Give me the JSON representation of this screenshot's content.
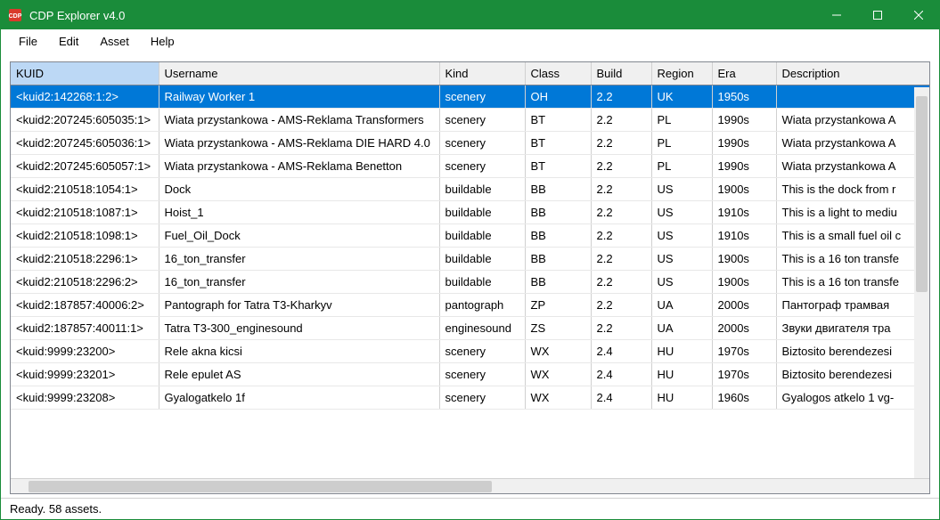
{
  "window": {
    "title": "CDP Explorer v4.0"
  },
  "menu": {
    "file": "File",
    "edit": "Edit",
    "asset": "Asset",
    "help": "Help"
  },
  "table": {
    "headers": {
      "kuid": "KUID",
      "username": "Username",
      "kind": "Kind",
      "class": "Class",
      "build": "Build",
      "region": "Region",
      "era": "Era",
      "description": "Description"
    },
    "rows": [
      {
        "kuid": "<kuid2:142268:1:2>",
        "username": "Railway Worker 1",
        "kind": "scenery",
        "class": "OH",
        "build": "2.2",
        "region": "UK",
        "era": "1950s",
        "description": "",
        "selected": true
      },
      {
        "kuid": "<kuid2:207245:605035:1>",
        "username": "Wiata przystankowa - AMS-Reklama Transformers",
        "kind": "scenery",
        "class": "BT",
        "build": "2.2",
        "region": "PL",
        "era": "1990s",
        "description": "Wiata przystankowa A"
      },
      {
        "kuid": "<kuid2:207245:605036:1>",
        "username": "Wiata przystankowa - AMS-Reklama DIE HARD 4.0",
        "kind": "scenery",
        "class": "BT",
        "build": "2.2",
        "region": "PL",
        "era": "1990s",
        "description": "Wiata przystankowa A"
      },
      {
        "kuid": "<kuid2:207245:605057:1>",
        "username": "Wiata przystankowa - AMS-Reklama Benetton",
        "kind": "scenery",
        "class": "BT",
        "build": "2.2",
        "region": "PL",
        "era": "1990s",
        "description": "Wiata przystankowa A"
      },
      {
        "kuid": "<kuid2:210518:1054:1>",
        "username": "Dock",
        "kind": "buildable",
        "class": "BB",
        "build": "2.2",
        "region": "US",
        "era": "1900s",
        "description": "This is the dock from r"
      },
      {
        "kuid": "<kuid2:210518:1087:1>",
        "username": "Hoist_1",
        "kind": "buildable",
        "class": "BB",
        "build": "2.2",
        "region": "US",
        "era": "1910s",
        "description": "This is a light to mediu"
      },
      {
        "kuid": "<kuid2:210518:1098:1>",
        "username": "Fuel_Oil_Dock",
        "kind": "buildable",
        "class": "BB",
        "build": "2.2",
        "region": "US",
        "era": "1910s",
        "description": "This is a small fuel oil c"
      },
      {
        "kuid": "<kuid2:210518:2296:1>",
        "username": "16_ton_transfer",
        "kind": "buildable",
        "class": "BB",
        "build": "2.2",
        "region": "US",
        "era": "1900s",
        "description": "This is a 16 ton transfe"
      },
      {
        "kuid": "<kuid2:210518:2296:2>",
        "username": "16_ton_transfer",
        "kind": "buildable",
        "class": "BB",
        "build": "2.2",
        "region": "US",
        "era": "1900s",
        "description": "This is a 16 ton transfe"
      },
      {
        "kuid": "<kuid2:187857:40006:2>",
        "username": "Pantograph for Tatra T3-Kharkyv",
        "kind": "pantograph",
        "class": "ZP",
        "build": "2.2",
        "region": "UA",
        "era": "2000s",
        "description": "Пантограф трамвая"
      },
      {
        "kuid": "<kuid2:187857:40011:1>",
        "username": "Tatra T3-300_enginesound",
        "kind": "enginesound",
        "class": "ZS",
        "build": "2.2",
        "region": "UA",
        "era": "2000s",
        "description": "Звуки двигателя тра"
      },
      {
        "kuid": "<kuid:9999:23200>",
        "username": "Rele akna kicsi",
        "kind": "scenery",
        "class": "WX",
        "build": "2.4",
        "region": "HU",
        "era": "1970s",
        "description": "Biztosito berendezesi"
      },
      {
        "kuid": "<kuid:9999:23201>",
        "username": "Rele epulet AS",
        "kind": "scenery",
        "class": "WX",
        "build": "2.4",
        "region": "HU",
        "era": "1970s",
        "description": "Biztosito berendezesi"
      },
      {
        "kuid": "<kuid:9999:23208>",
        "username": "Gyalogatkelo 1f",
        "kind": "scenery",
        "class": "WX",
        "build": "2.4",
        "region": "HU",
        "era": "1960s",
        "description": "Gyalogos atkelo 1 vg-"
      }
    ]
  },
  "status": {
    "text": "Ready.  58 assets."
  }
}
